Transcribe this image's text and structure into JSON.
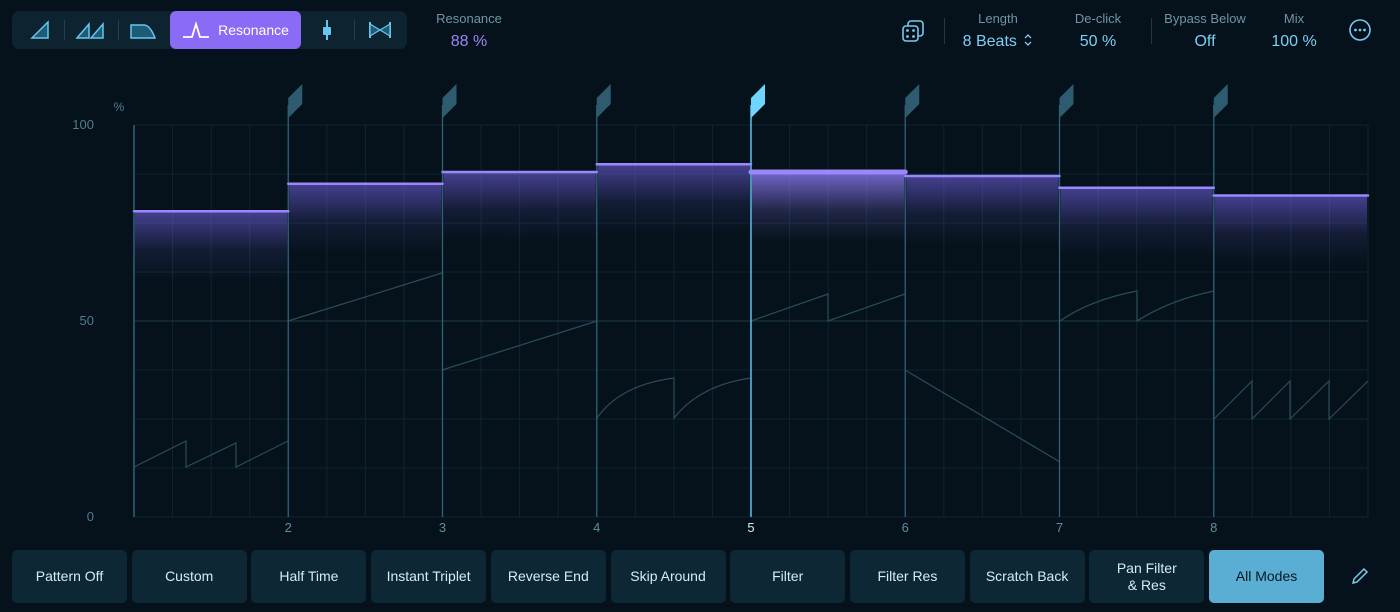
{
  "modes": {
    "active_label": "Resonance",
    "items": [
      {
        "name": "ramp-icon"
      },
      {
        "name": "double-ramp-icon"
      },
      {
        "name": "filter-slope-icon"
      },
      {
        "name": "resonance-icon"
      },
      {
        "name": "fader-icon"
      },
      {
        "name": "bowtie-icon"
      }
    ]
  },
  "resonance": {
    "label": "Resonance",
    "value": "88 %"
  },
  "randomize_icon": "dice-icon",
  "length": {
    "label": "Length",
    "value": "8 Beats"
  },
  "declick": {
    "label": "De-click",
    "value": "50 %"
  },
  "bypass": {
    "label": "Bypass Below",
    "value": "Off"
  },
  "mix": {
    "label": "Mix",
    "value": "100 %"
  },
  "more_icon": "more-icon",
  "colors": {
    "accent": "#8a6bf5",
    "accent_value": "#9d86f7",
    "cyan": "#78d6ff",
    "value_text": "#7dcff5",
    "step_bar": "#9c87fa",
    "marker": "#2e5b70",
    "marker_active": "#6fd5ff"
  },
  "chart_data": {
    "type": "step",
    "ylabel": "%",
    "ylim": [
      0,
      100
    ],
    "yticks": [
      0,
      50,
      100
    ],
    "xticks": [
      "2",
      "3",
      "4",
      "5",
      "6",
      "7",
      "8"
    ],
    "active_step": 5,
    "steps": [
      78,
      85,
      88,
      90,
      88,
      87,
      84,
      82
    ]
  },
  "presets": [
    {
      "label": "Pattern Off",
      "active": false
    },
    {
      "label": "Custom",
      "active": false
    },
    {
      "label": "Half Time",
      "active": false
    },
    {
      "label": "Instant Triplet",
      "active": false
    },
    {
      "label": "Reverse End",
      "active": false
    },
    {
      "label": "Skip Around",
      "active": false
    },
    {
      "label": "Filter",
      "active": false
    },
    {
      "label": "Filter Res",
      "active": false
    },
    {
      "label": "Scratch Back",
      "active": false
    },
    {
      "label": "Pan Filter\n& Res",
      "active": false
    },
    {
      "label": "All Modes",
      "active": true
    }
  ],
  "pencil_icon": "pencil-icon"
}
